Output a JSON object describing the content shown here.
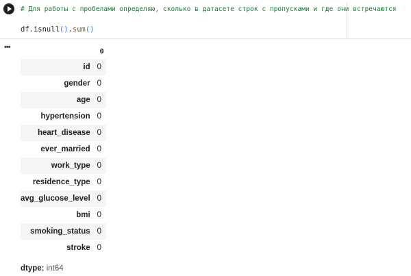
{
  "cell": {
    "comment": "# Для работы с пробелами определяю, сколько в датасете строк с пропусками и где они встречаются",
    "code_obj": "df.isnull",
    "code_paren1": "()",
    "code_dot": ".",
    "code_fn": "sum",
    "code_paren2": "()"
  },
  "output": {
    "menu": "•••",
    "column_header": "0",
    "rows": [
      {
        "name": "id",
        "value": "0"
      },
      {
        "name": "gender",
        "value": "0"
      },
      {
        "name": "age",
        "value": "0"
      },
      {
        "name": "hypertension",
        "value": "0"
      },
      {
        "name": "heart_disease",
        "value": "0"
      },
      {
        "name": "ever_married",
        "value": "0"
      },
      {
        "name": "work_type",
        "value": "0"
      },
      {
        "name": "residence_type",
        "value": "0"
      },
      {
        "name": "avg_glucose_level",
        "value": "0"
      },
      {
        "name": "bmi",
        "value": "0"
      },
      {
        "name": "smoking_status",
        "value": "0"
      },
      {
        "name": "stroke",
        "value": "0"
      }
    ],
    "dtype_label": "dtype:",
    "dtype_value": "int64"
  }
}
